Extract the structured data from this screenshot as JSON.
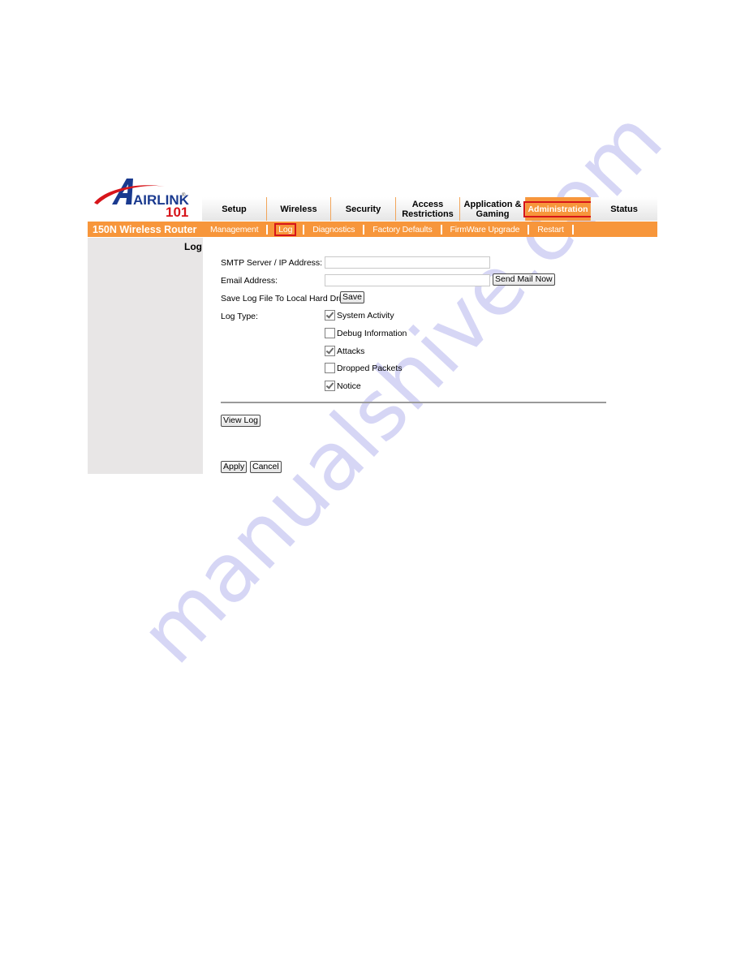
{
  "watermark": "manualshive.com",
  "brand": {
    "logo_text": "AIRLINK",
    "logo_number": "101",
    "product_name": "150N Wireless Router",
    "colors": {
      "orange": "#f7963b",
      "active_outline": "#d7141a",
      "logo_blue": "#1a3a8f",
      "logo_red": "#d7141a",
      "sidebar": "#e8e6e6"
    }
  },
  "tabs": [
    {
      "label": "Setup",
      "active": false
    },
    {
      "label": "Wireless",
      "active": false
    },
    {
      "label": "Security",
      "active": false
    },
    {
      "label": "Access Restrictions",
      "active": false
    },
    {
      "label": "Application & Gaming",
      "active": false
    },
    {
      "label": "Administration",
      "active": true
    },
    {
      "label": "Status",
      "active": false
    }
  ],
  "subnav": [
    {
      "label": "Management",
      "active": false
    },
    {
      "label": "Log",
      "active": true
    },
    {
      "label": "Diagnostics",
      "active": false
    },
    {
      "label": "Factory Defaults",
      "active": false
    },
    {
      "label": "FirmWare Upgrade",
      "active": false
    },
    {
      "label": "Restart",
      "active": false
    }
  ],
  "page": {
    "title": "Log",
    "smtp": {
      "label": "SMTP Server / IP Address:",
      "value": ""
    },
    "email": {
      "label": "Email Address:",
      "value": "",
      "send_button": "Send Mail Now"
    },
    "save_log": {
      "label": "Save Log File To Local Hard Drive:",
      "button": "Save"
    },
    "log_type": {
      "label": "Log Type:",
      "options": [
        {
          "label": "System Activity",
          "checked": true
        },
        {
          "label": "Debug Information",
          "checked": false
        },
        {
          "label": "Attacks",
          "checked": true
        },
        {
          "label": "Dropped Packets",
          "checked": false
        },
        {
          "label": "Notice",
          "checked": true
        }
      ]
    },
    "view_log_button": "View Log",
    "apply_button": "Apply",
    "cancel_button": "Cancel"
  }
}
